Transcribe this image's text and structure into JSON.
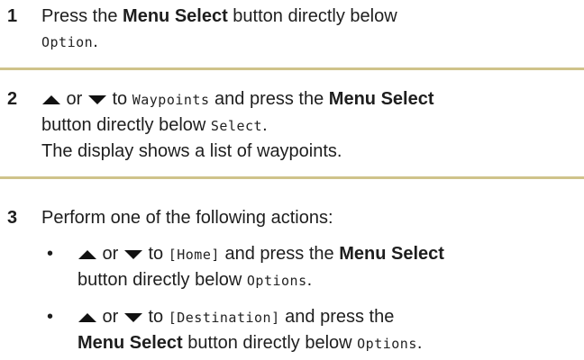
{
  "step1": {
    "number": "1",
    "pre": "Press the ",
    "bold": "Menu Select",
    "post": " button directly below",
    "lcd": "Option",
    "end": "."
  },
  "step2": {
    "number": "2",
    "or": " or ",
    "to": " to ",
    "lcd1": "Waypoints",
    "mid": " and press the ",
    "bold": "Menu Select",
    "line2": "button directly below ",
    "lcd2": "Select",
    "end": ".",
    "result": "The display shows a list of waypoints."
  },
  "step3": {
    "number": "3",
    "text": "Perform one of the following actions:",
    "bullets": [
      {
        "or": " or ",
        "to": " to ",
        "lcd1": "[Home]",
        "mid": " and press the ",
        "bold": "Menu Select",
        "line2": "button directly below ",
        "lcd2": "Options",
        "end": "."
      },
      {
        "or": " or ",
        "to": " to ",
        "lcd1": "[Destination]",
        "mid": " and press the",
        "bold": "Menu Select",
        "line2": " button directly below ",
        "lcd2": "Options",
        "end": "."
      }
    ]
  },
  "icons": [
    "up-arrow-icon",
    "down-arrow-icon"
  ],
  "colors": {
    "separator": "#cfc38a",
    "text": "#1e1e1e"
  }
}
